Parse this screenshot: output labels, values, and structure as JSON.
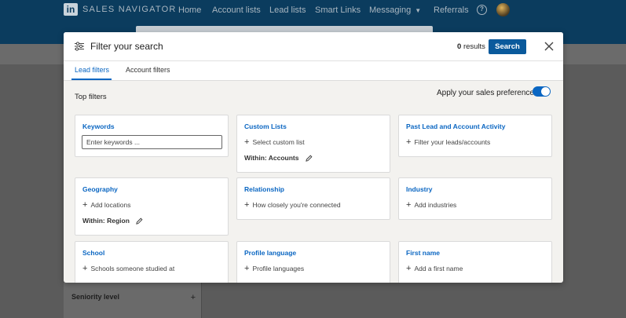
{
  "navbar": {
    "logo_mark": "in",
    "brand": "SALES NAVIGATOR",
    "items": [
      {
        "label": "Home"
      },
      {
        "label": "Account lists"
      },
      {
        "label": "Lead lists"
      },
      {
        "label": "Smart Links"
      },
      {
        "label": "Messaging"
      },
      {
        "label": "Referrals"
      }
    ],
    "help_glyph": "?"
  },
  "background": {
    "left_panel_item": "Seniority level"
  },
  "modal": {
    "title": "Filter your search",
    "results_count": "0",
    "results_label": "results",
    "search_button": "Search",
    "tabs": [
      {
        "label": "Lead filters",
        "active": true
      },
      {
        "label": "Account filters",
        "active": false
      }
    ],
    "section_title": "Top filters",
    "preferences_label": "Apply your sales preferences",
    "preferences_on": true,
    "accent_color": "#0a66c2",
    "cards": {
      "keywords": {
        "title": "Keywords",
        "placeholder": "Enter keywords ..."
      },
      "custom_lists": {
        "title": "Custom Lists",
        "action": "Select custom list",
        "within": "Within: Accounts"
      },
      "past_activity": {
        "title": "Past Lead and Account Activity",
        "action": "Filter your leads/accounts"
      },
      "geography": {
        "title": "Geography",
        "action": "Add locations",
        "within": "Within: Region"
      },
      "relationship": {
        "title": "Relationship",
        "action": "How closely you're connected"
      },
      "industry": {
        "title": "Industry",
        "action": "Add industries"
      },
      "school": {
        "title": "School",
        "action": "Schools someone studied at"
      },
      "profile_language": {
        "title": "Profile language",
        "action": "Profile languages"
      },
      "first_name": {
        "title": "First name",
        "action": "Add a first name"
      }
    },
    "plus_glyph": "+"
  }
}
